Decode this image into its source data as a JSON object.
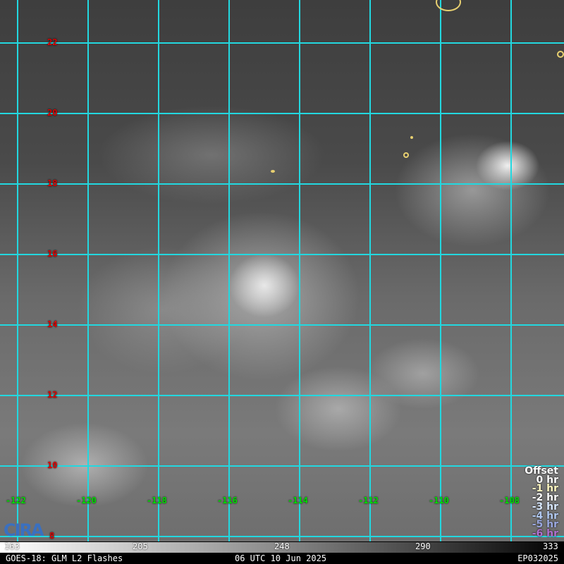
{
  "map": {
    "lat_labels": [
      "22",
      "20",
      "18",
      "16",
      "14",
      "12",
      "10",
      "8"
    ],
    "lon_labels": [
      "-122",
      "-120",
      "-118",
      "-116",
      "-114",
      "-112",
      "-110",
      "-108"
    ],
    "grid_color": "#22d8e0"
  },
  "offset": {
    "title": "Offset",
    "items": [
      {
        "label": "0 hr",
        "color": "#ffffff"
      },
      {
        "label": "-1 hr",
        "color": "#fff8c0"
      },
      {
        "label": "-2 hr",
        "color": "#ffffff"
      },
      {
        "label": "-3 hr",
        "color": "#d8e8ff"
      },
      {
        "label": "-4 hr",
        "color": "#b0c8f0"
      },
      {
        "label": "-5 hr",
        "color": "#9aa8e0"
      },
      {
        "label": "-6 hr",
        "color": "#b070d0"
      }
    ]
  },
  "logo": "CIRA",
  "colorbar": {
    "ticks": [
      "163",
      "205",
      "248",
      "290",
      "333"
    ]
  },
  "footer": {
    "left": "GOES-18: GLM L2 Flashes",
    "center": "06 UTC 10 Jun 2025",
    "right": "EP032025"
  }
}
